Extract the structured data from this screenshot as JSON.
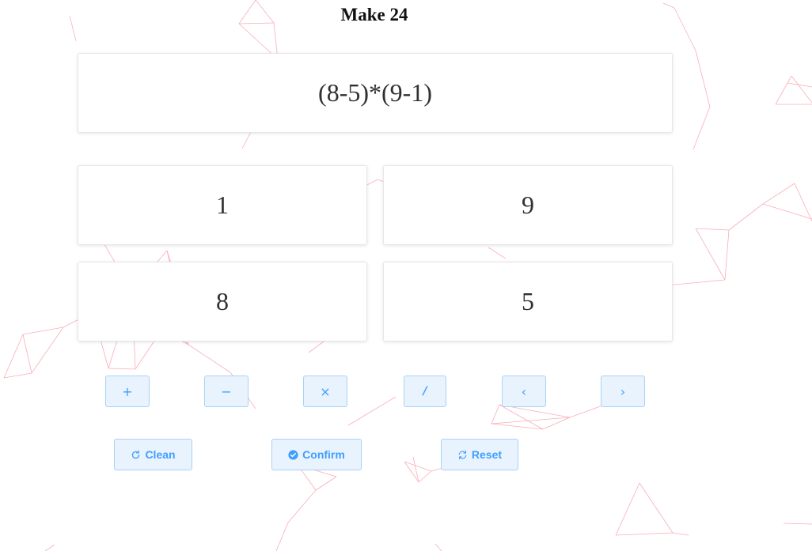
{
  "title": "Make 24",
  "expression": "(8-5)*(9-1)",
  "numbers": [
    "1",
    "9",
    "8",
    "5"
  ],
  "operators": [
    {
      "label": "+",
      "icon": "plus-icon"
    },
    {
      "label": "−",
      "icon": "minus-icon"
    },
    {
      "label": "×",
      "icon": "multiply-icon"
    },
    {
      "label": "/",
      "icon": "divide-icon"
    },
    {
      "label": "‹",
      "icon": "left-paren-icon"
    },
    {
      "label": "›",
      "icon": "right-paren-icon"
    }
  ],
  "actions": [
    {
      "label": "Clean",
      "icon": "refresh-icon"
    },
    {
      "label": "Confirm",
      "icon": "check-circle-icon"
    },
    {
      "label": "Reset",
      "icon": "reset-icon"
    }
  ],
  "colors": {
    "accent": "#409eff",
    "button_bg": "#e9f3fd",
    "button_border": "#a9d2f6",
    "particle_line": "#f36b7f"
  }
}
